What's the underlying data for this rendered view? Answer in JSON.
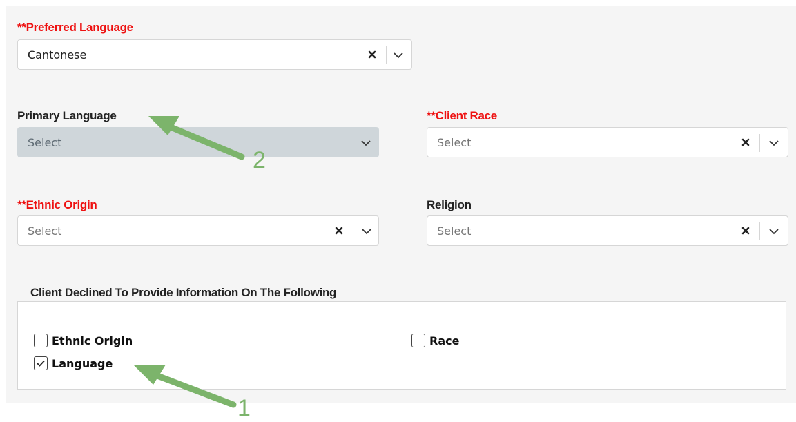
{
  "fields": {
    "preferred_language": {
      "label": "**Preferred Language",
      "value": "Cantonese"
    },
    "primary_language": {
      "label": "Primary Language",
      "placeholder": "Select"
    },
    "client_race": {
      "label": "**Client Race",
      "placeholder": "Select"
    },
    "ethnic_origin": {
      "label": "**Ethnic Origin",
      "placeholder": "Select"
    },
    "religion": {
      "label": "Religion",
      "placeholder": "Select"
    }
  },
  "declined": {
    "legend": "Client Declined To Provide Information On The Following",
    "options": {
      "ethnic_origin": {
        "label": "Ethnic Origin",
        "checked": false
      },
      "race": {
        "label": "Race",
        "checked": false
      },
      "language": {
        "label": "Language",
        "checked": true
      }
    }
  },
  "annotations": {
    "arrow_1": "1",
    "arrow_2": "2"
  },
  "colors": {
    "required": "#ee1111",
    "annotation": "#7cb46b",
    "disabled_bg": "#cfd6da"
  },
  "icons": {
    "clear": "times-icon",
    "dropdown": "chevron-down-icon",
    "check": "check-icon"
  }
}
